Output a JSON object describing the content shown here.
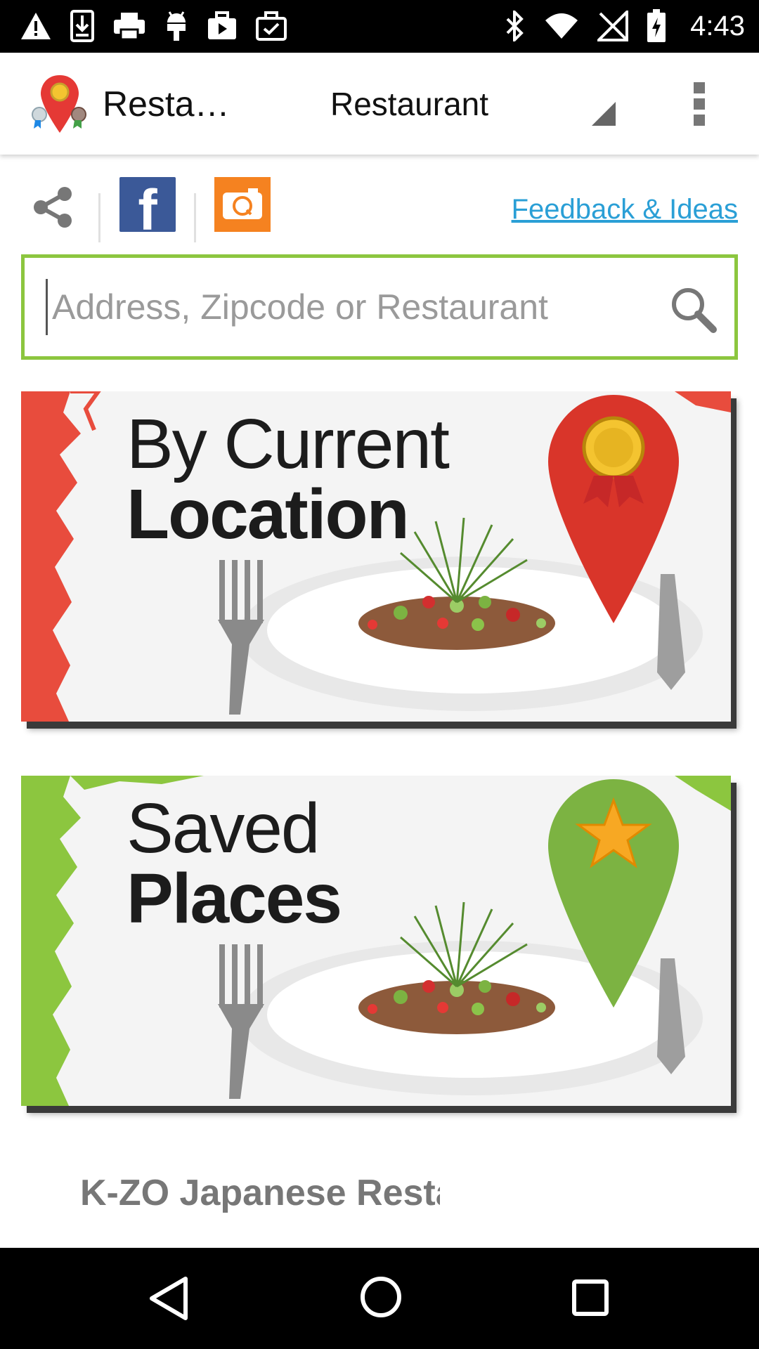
{
  "status_bar": {
    "time": "4:43",
    "left_icons": [
      "warning-icon",
      "download-icon",
      "print-icon",
      "android-icon",
      "video-bag-icon",
      "briefcase-check-icon"
    ],
    "right_icons": [
      "bluetooth-icon",
      "wifi-icon",
      "no-signal-icon",
      "battery-charging-icon"
    ]
  },
  "action_bar": {
    "app_title": "Resta…",
    "category_selected": "Restaurant",
    "overflow_icon": "more-vert-icon"
  },
  "share_row": {
    "feedback_label": "Feedback & Ideas"
  },
  "search": {
    "placeholder": "Address, Zipcode or Restaurant",
    "value": ""
  },
  "banners": {
    "current_location": {
      "line1": "By Current",
      "line2": "Location",
      "accent": "#e84c3d"
    },
    "saved_places": {
      "line1": "Saved",
      "line2": "Places",
      "accent": "#8cc63f"
    }
  },
  "list": {
    "first_item": "K-ZO Japanese Restaurant"
  },
  "colors": {
    "search_border": "#8cc63f",
    "link": "#2a9fd6",
    "facebook": "#3b5998",
    "camera": "#f58220"
  }
}
